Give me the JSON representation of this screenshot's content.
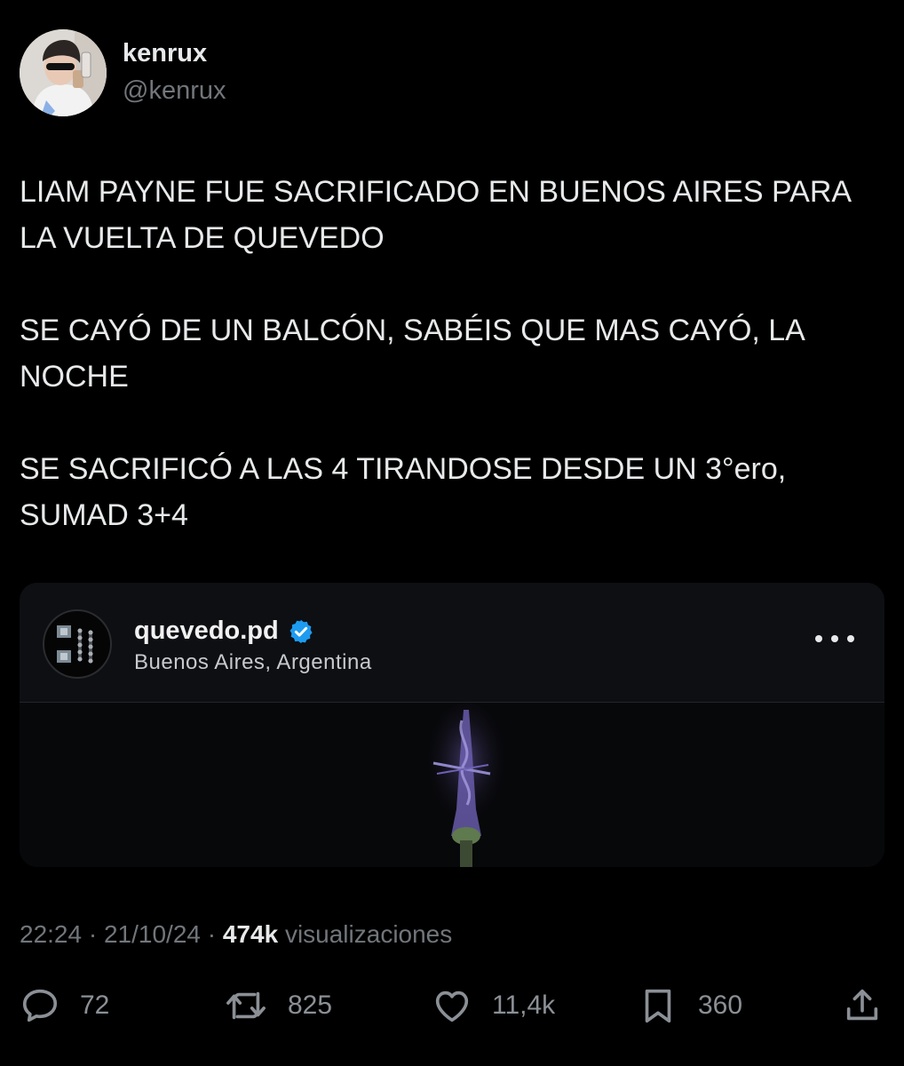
{
  "author": {
    "name": "kenrux",
    "handle": "@kenrux"
  },
  "tweet": {
    "paragraphs": [
      "LIAM PAYNE FUE SACRIFICADO EN BUENOS AIRES PARA LA VUELTA DE QUEVEDO",
      "SE CAYÓ DE UN BALCÓN, SABÉIS QUE MAS CAYÓ, LA NOCHE",
      "SE SACRIFICÓ A LAS 4 TIRANDOSE DESDE UN 3°ero, SUMAD 3+4"
    ]
  },
  "embed": {
    "username": "quevedo.pd",
    "verified": true,
    "location": "Buenos Aires, Argentina"
  },
  "meta": {
    "time": "22:24",
    "date": "21/10/24",
    "separator": "·",
    "views_count": "474k",
    "views_label": "visualizaciones"
  },
  "actions": {
    "replies": "72",
    "reposts": "825",
    "likes": "11,4k",
    "bookmarks": "360"
  },
  "colors": {
    "background": "#000000",
    "text": "#e7e9ea",
    "muted": "#71767b",
    "verified": "#1d9bf0"
  },
  "icons": {
    "reply": "reply-icon",
    "repost": "repost-icon",
    "like": "heart-icon",
    "bookmark": "bookmark-icon",
    "share": "share-icon",
    "more": "more-icon",
    "verified": "verified-badge-icon"
  }
}
